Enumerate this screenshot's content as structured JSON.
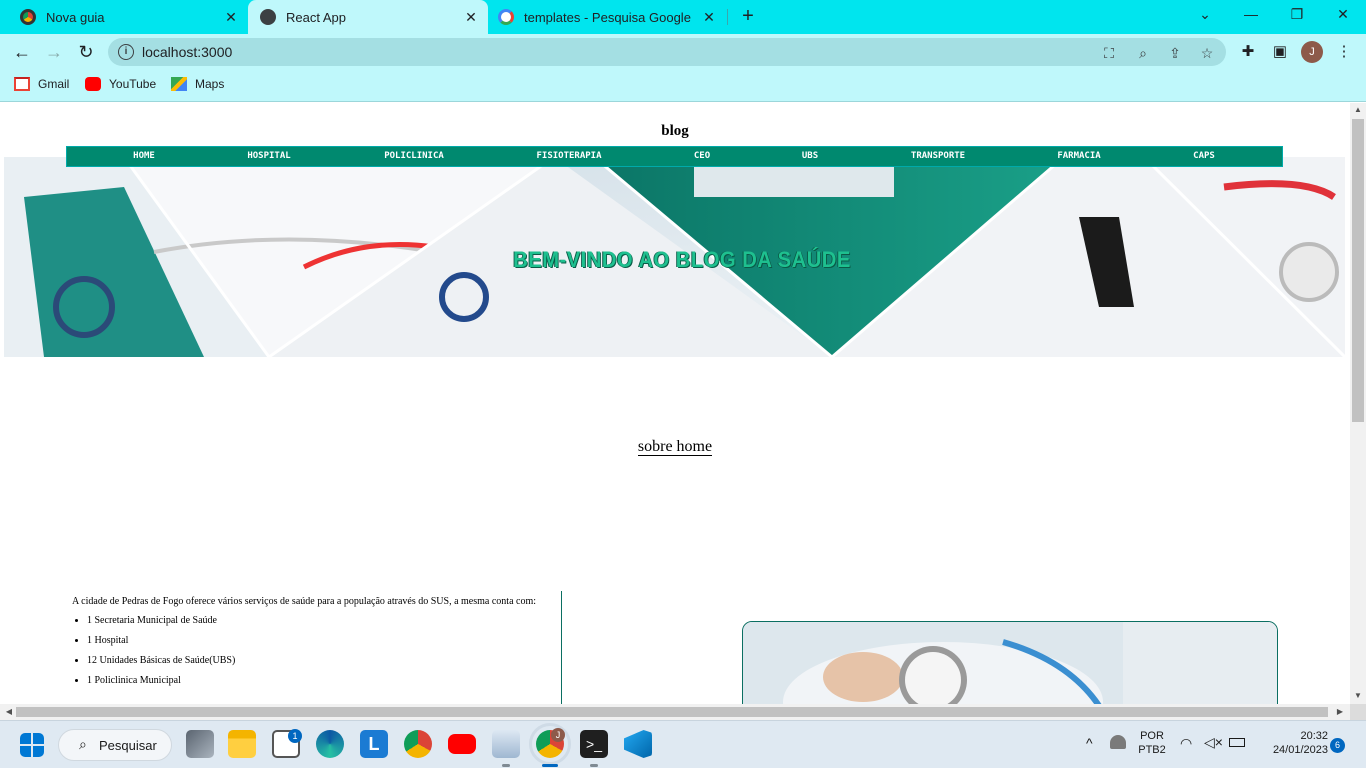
{
  "browser": {
    "tabs": [
      {
        "title": "Nova guia",
        "icon": "chrome-icon",
        "active": false
      },
      {
        "title": "React App",
        "icon": "globe-icon",
        "active": true
      },
      {
        "title": "templates - Pesquisa Google",
        "icon": "google-icon",
        "active": false
      }
    ],
    "new_tab_symbol": "+",
    "url": "localhost:3000",
    "bookmarks": [
      {
        "label": "Gmail",
        "icon": "gmail-icon"
      },
      {
        "label": "YouTube",
        "icon": "youtube-icon"
      },
      {
        "label": "Maps",
        "icon": "maps-icon"
      }
    ],
    "profile_initial": "J"
  },
  "page": {
    "title": "blog",
    "menu": [
      "HOME",
      "HOSPITAL",
      "POLICLINICA",
      "FISIOTERAPIA",
      "CEO",
      "UBS",
      "TRANSPORTE",
      "FARMACIA",
      "CAPS"
    ],
    "banner_text": "BEM-VINDO AO BLOG DA SAÚDE",
    "section_link": "sobre home",
    "services_intro": "A cidade de Pedras de Fogo oferece vários serviços de saúde para a população através do SUS, a mesma conta com:",
    "services": [
      "1 Secretaria Municipal de Saúde",
      "1 Hospital",
      "12 Unidades Básicas de Saúde(UBS)",
      "1 Policlinica Municipal"
    ]
  },
  "taskbar": {
    "search_label": "Pesquisar",
    "store_badge": "1",
    "chrome_badge": "J",
    "language": "POR",
    "layout": "PTB2",
    "time": "20:32",
    "date": "24/01/2023",
    "notification_count": "6"
  },
  "colors": {
    "tab_strip": "#00e5ee",
    "toolbar": "#bff8fb",
    "menu_bg": "#00896f",
    "banner_text": "#1ec08f"
  }
}
